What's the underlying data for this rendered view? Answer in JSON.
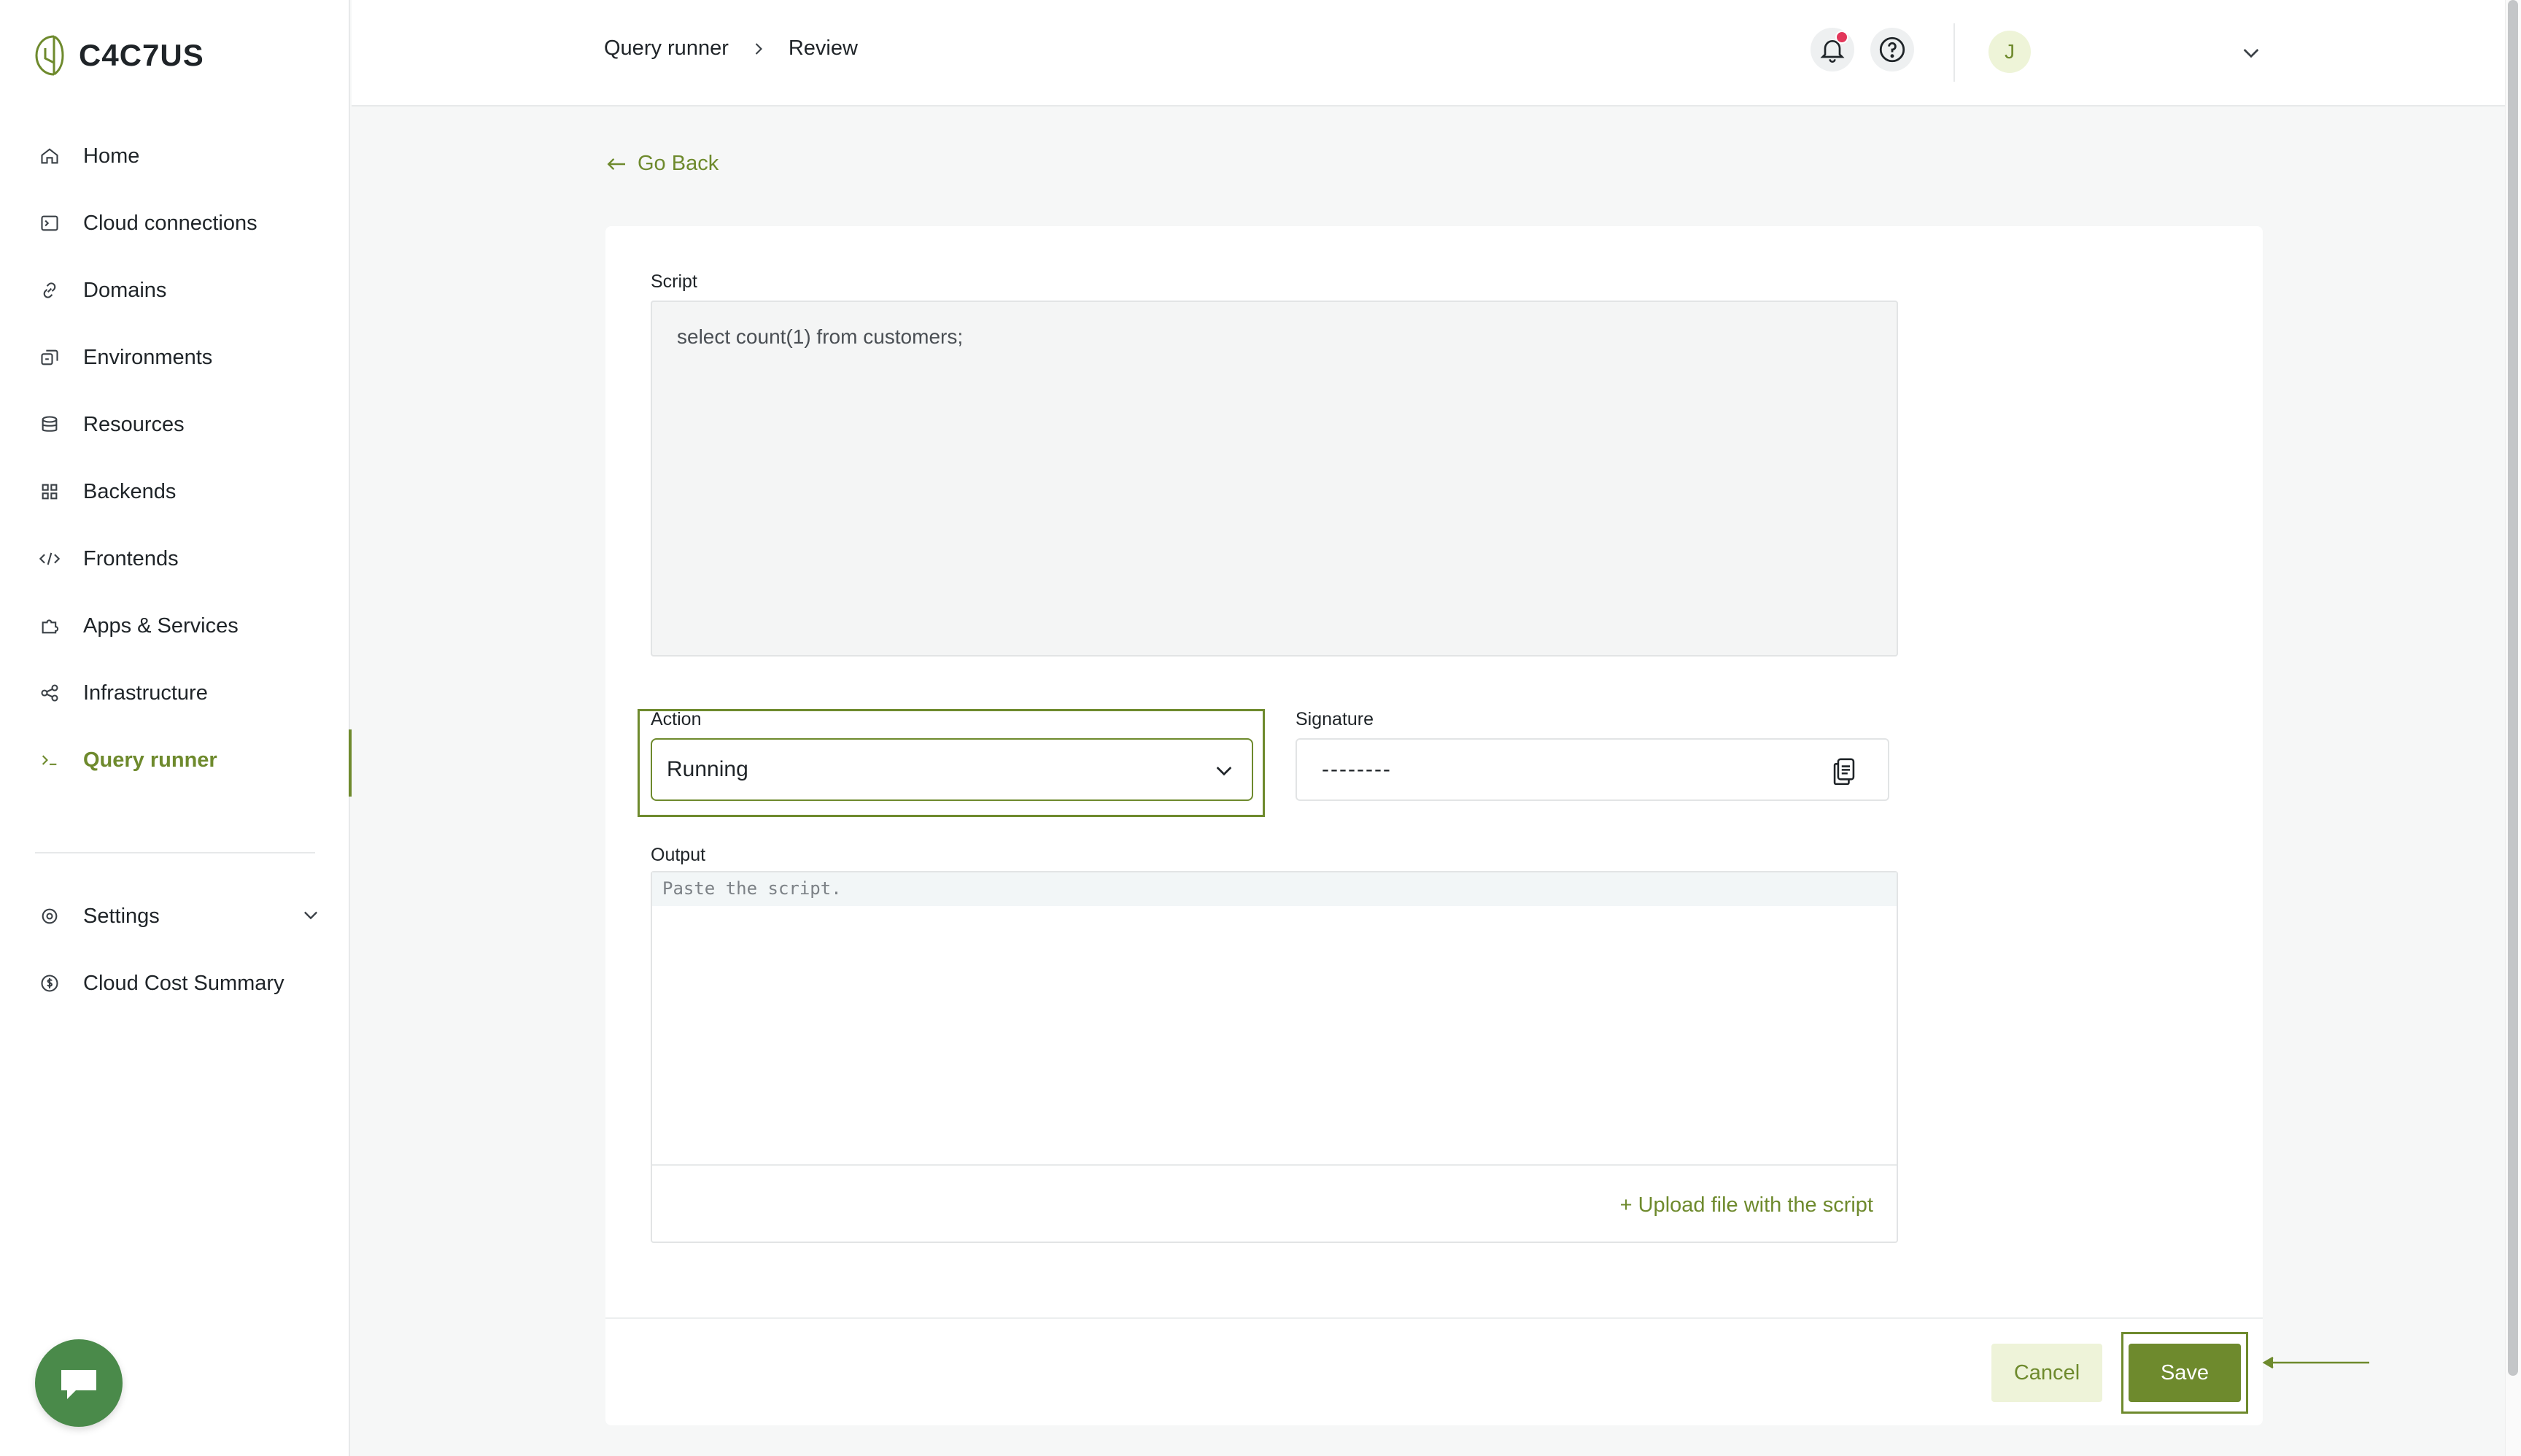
{
  "app": {
    "brand": "C4C7US"
  },
  "sidebar": {
    "items": [
      {
        "label": "Home",
        "icon": "home-icon"
      },
      {
        "label": "Cloud connections",
        "icon": "terminal-box-icon"
      },
      {
        "label": "Domains",
        "icon": "link-icon"
      },
      {
        "label": "Environments",
        "icon": "environments-icon"
      },
      {
        "label": "Resources",
        "icon": "database-icon"
      },
      {
        "label": "Backends",
        "icon": "grid-icon"
      },
      {
        "label": "Frontends",
        "icon": "code-icon"
      },
      {
        "label": "Apps & Services",
        "icon": "puzzle-icon"
      },
      {
        "label": "Infrastructure",
        "icon": "share-nodes-icon"
      },
      {
        "label": "Query runner",
        "icon": "prompt-icon",
        "active": true
      }
    ],
    "bottom_items": [
      {
        "label": "Settings",
        "icon": "gear-icon"
      },
      {
        "label": "Cloud Cost Summary",
        "icon": "dollar-circle-icon"
      }
    ]
  },
  "header": {
    "breadcrumb": [
      "Query runner",
      "Review"
    ],
    "avatar_initial": "J"
  },
  "main": {
    "go_back": "Go Back",
    "script": {
      "label": "Script",
      "value": "select count(1) from customers;"
    },
    "action": {
      "label": "Action",
      "selected": "Running"
    },
    "signature": {
      "label": "Signature",
      "value": "--------"
    },
    "output": {
      "label": "Output",
      "placeholder": "Paste the script.",
      "upload_link": "+ Upload file with the script"
    },
    "buttons": {
      "cancel": "Cancel",
      "save": "Save"
    }
  },
  "colors": {
    "accent": "#6e8a2d",
    "accent_light": "#eef3d9",
    "notification": "#e2365a",
    "chat": "#4a8a4a"
  }
}
